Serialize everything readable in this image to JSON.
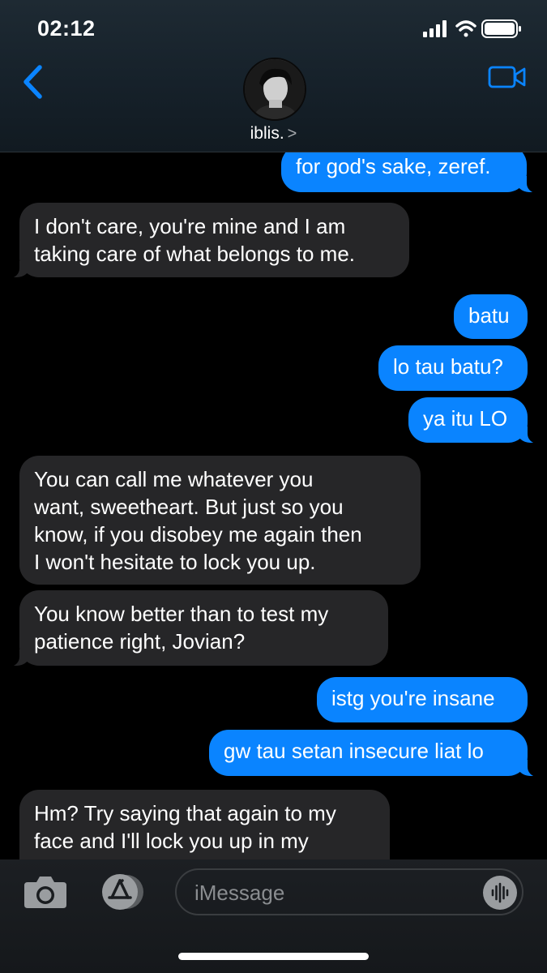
{
  "status_bar": {
    "time": "02:12"
  },
  "header": {
    "contact_name": "iblis.",
    "chevron": ">"
  },
  "messages": [
    {
      "side": "sent",
      "text": "for god's sake, zeref."
    },
    {
      "side": "recv",
      "text": "I don't care, you're mine and I am\ntaking care of what belongs to me."
    },
    {
      "side": "sent",
      "text": "batu"
    },
    {
      "side": "sent",
      "text": "lo tau batu?"
    },
    {
      "side": "sent",
      "text": "ya itu LO"
    },
    {
      "side": "recv",
      "text": "You can call me whatever you\nwant, sweetheart. But just so you\nknow, if you disobey me again then\nI won't hesitate to lock you up."
    },
    {
      "side": "recv",
      "text": "You know better than to test my\npatience right, Jovian?"
    },
    {
      "side": "sent",
      "text": "istg you're insane"
    },
    {
      "side": "sent",
      "text": "gw tau setan insecure liat lo"
    },
    {
      "side": "recv",
      "text": "Hm? Try saying that again to my\nface and I'll lock you up in my"
    }
  ],
  "composer": {
    "placeholder": "iMessage"
  },
  "colors": {
    "sent_bubble": "#0a84ff",
    "recv_bubble": "#262628",
    "accent": "#0a84ff"
  },
  "icons": [
    "back-chevron-icon",
    "video-camera-icon",
    "camera-icon",
    "app-store-icon",
    "audio-waveform-icon",
    "signal-icon",
    "wifi-icon",
    "battery-icon"
  ]
}
